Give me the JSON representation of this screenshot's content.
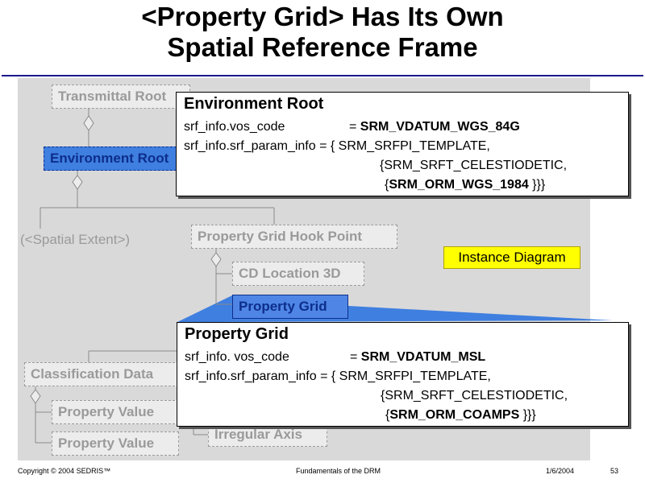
{
  "title": {
    "line1": "<Property Grid> Has Its Own",
    "line2": "Spatial Reference Frame"
  },
  "diagram": {
    "boxes": {
      "transmittal_root": "Transmittal Root",
      "environment_root": "Environment Root",
      "spatial_extent": "(<Spatial Extent>)",
      "property_grid_hook_point": "Property Grid Hook Point",
      "cd_location_3d": "CD Location 3D",
      "property_grid": "Property Grid",
      "classification_data": "Classification Data",
      "property_value_1": "Property Value",
      "property_value_2": "Property Value",
      "irregular_axis": "Irregular Axis"
    },
    "instance_label": "Instance Diagram"
  },
  "callout_env": {
    "heading": "Environment Root",
    "vos_key": "srf_info.vos_code",
    "vos_eq": "=",
    "vos_value": "SRM_VDATUM_WGS_84G",
    "param_key": "srf_info.srf_param_info",
    "param_open": "= { SRM_SRFPI_TEMPLATE,",
    "param_line2": "{SRM_SRFT_CELESTIODETIC,",
    "param_line3_open": "{",
    "param_line3_bold": "SRM_ORM_WGS_1984",
    "param_line3_close": " }}}"
  },
  "callout_pg": {
    "heading": "Property Grid",
    "vos_key": "srf_info. vos_code",
    "vos_eq": "=",
    "vos_value": "SRM_VDATUM_MSL",
    "param_key": "srf_info.srf_param_info",
    "param_open": "= { SRM_SRFPI_TEMPLATE,",
    "param_line2": "{SRM_SRFT_CELESTIODETIC,",
    "param_line3_open": "{",
    "param_line3_bold": "SRM_ORM_COAMPS",
    "param_line3_close": " }}}"
  },
  "footer": {
    "copyright": "Copyright © 2004 SEDRIS™",
    "center": "Fundamentals of the DRM",
    "date": "1/6/2004",
    "page": "53"
  },
  "colors": {
    "highlight": "#3f7fe0",
    "title_rule": "#1a1a8c",
    "instance_bg": "#ffff00",
    "diagram_bg": "#d9d9d9"
  }
}
